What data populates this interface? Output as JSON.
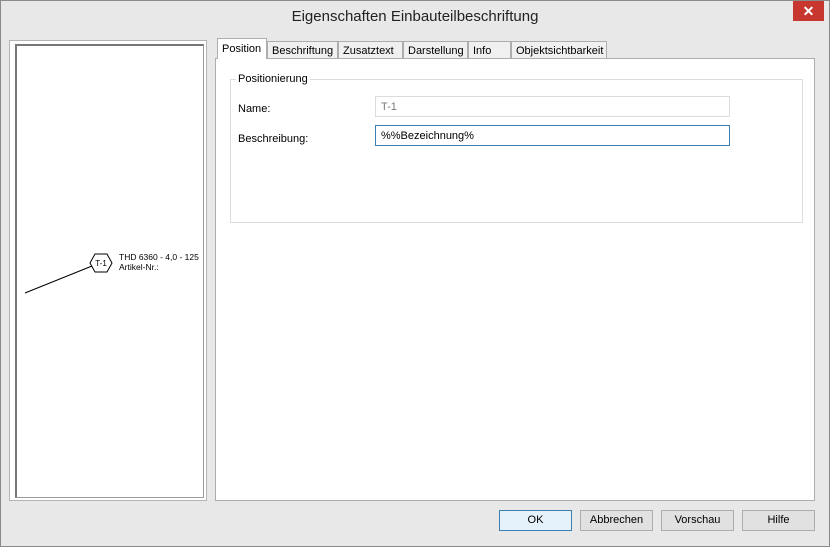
{
  "window": {
    "title": "Eigenschaften Einbauteilbeschriftung",
    "close_glyph": "✕"
  },
  "preview": {
    "symbol_label": "T-1",
    "text_line1": "THD 6360 - 4,0 - 125",
    "text_line2": "Artikel-Nr.:"
  },
  "tabs": [
    {
      "label": "Position",
      "active": true
    },
    {
      "label": "Beschriftung",
      "active": false
    },
    {
      "label": "Zusatztext",
      "active": false
    },
    {
      "label": "Darstellung",
      "active": false
    },
    {
      "label": "Info",
      "active": false
    },
    {
      "label": "Objektsichtbarkeit",
      "active": false
    }
  ],
  "positionierung": {
    "group_title": "Positionierung",
    "name_label": "Name:",
    "name_value": "T-1",
    "beschreibung_label": "Beschreibung:",
    "beschreibung_value": "%%Bezeichnung%"
  },
  "buttons": {
    "ok": "OK",
    "cancel": "Abbrechen",
    "preview": "Vorschau",
    "help": "Hilfe"
  },
  "colors": {
    "close_button": "#c7372f",
    "focus_border": "#3c7fb1"
  }
}
